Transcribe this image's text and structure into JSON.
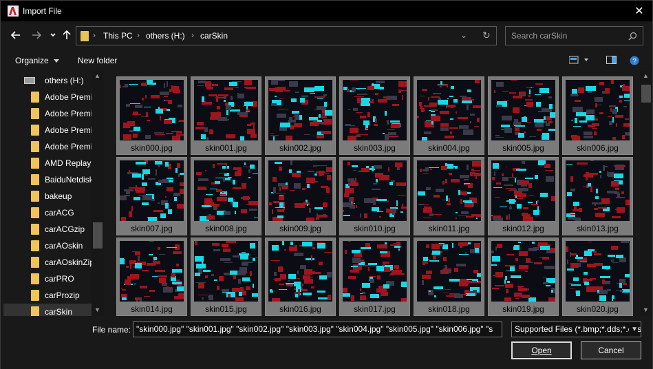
{
  "window": {
    "title": "Import File",
    "close_glyph": "✕"
  },
  "address": {
    "crumbs": [
      "This PC",
      "others (H:)",
      "carSkin"
    ],
    "dropdown_glyph": "⌄",
    "refresh_glyph": "↻"
  },
  "search": {
    "placeholder": "Search carSkin",
    "icon": "search-icon"
  },
  "toolbar": {
    "organize_label": "Organize",
    "new_folder_label": "New folder"
  },
  "nav": {
    "drive": "others (H:)",
    "items": [
      "Adobe Premi",
      "Adobe Premi",
      "Adobe Premi",
      "Adobe Premi",
      "AMD Replay",
      "BaiduNetdisk",
      "bakeup",
      "carACG",
      "carACGzip",
      "carAOskin",
      "carAOskinZip",
      "carPRO",
      "carProzip",
      "carSkin"
    ],
    "selected_index": 13
  },
  "files": [
    "skin000.jpg",
    "skin001.jpg",
    "skin002.jpg",
    "skin003.jpg",
    "skin004.jpg",
    "skin005.jpg",
    "skin006.jpg",
    "skin007.jpg",
    "skin008.jpg",
    "skin009.jpg",
    "skin010.jpg",
    "skin011.jpg",
    "skin012.jpg",
    "skin013.jpg",
    "skin014.jpg",
    "skin015.jpg",
    "skin016.jpg",
    "skin017.jpg",
    "skin018.jpg",
    "skin019.jpg",
    "skin020.jpg"
  ],
  "bottom": {
    "file_name_label": "File name:",
    "file_name_value": "\"skin000.jpg\" \"skin001.jpg\" \"skin002.jpg\" \"skin003.jpg\" \"skin004.jpg\" \"skin005.jpg\" \"skin006.jpg\" \"s",
    "filter_value": "Supported Files (*.bmp;*.dds;*.dds",
    "open_label": "Open",
    "cancel_label": "Cancel"
  },
  "colors": {
    "folder": "#f0c45a",
    "thumb_red": "#a0141e",
    "thumb_cyan": "#19d8e6",
    "tile_bg": "#7b7b7b"
  }
}
